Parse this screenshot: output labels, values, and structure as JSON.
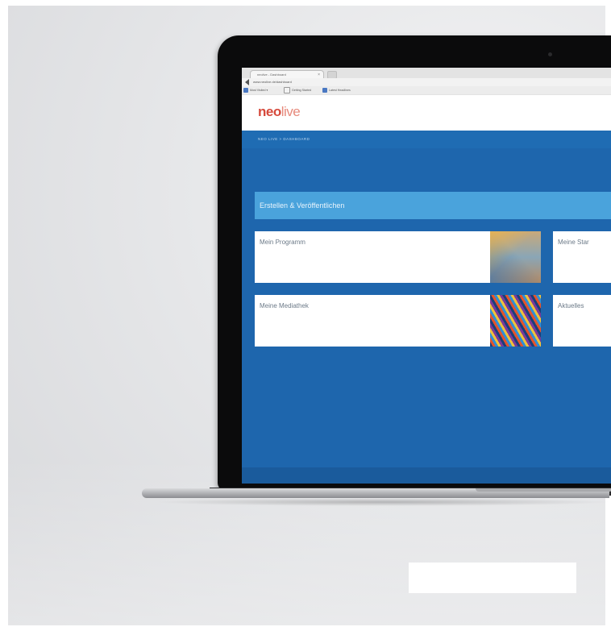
{
  "browser": {
    "tab_title": "neolive - Dashboard",
    "tab_close": "×",
    "address": "www.neolive.de/dashboard",
    "bookmarks": [
      {
        "label": "Most Visited ▾"
      },
      {
        "label": "Getting Started"
      },
      {
        "label": "Latest Headlines"
      }
    ]
  },
  "site": {
    "logo_part1": "neo",
    "logo_part2": "live",
    "breadcrumb": "NEO LIVE  >  DASHBOARD"
  },
  "dashboard": {
    "create_section_label": "Erstellen & Veröffentlichen",
    "cards": [
      {
        "title": "Mein Programm"
      },
      {
        "title": "Meine Star"
      },
      {
        "title": "Meine Mediathek"
      },
      {
        "title": "Aktuelles"
      }
    ]
  },
  "colors": {
    "brand_blue": "#1e66ad",
    "accent_light_blue": "#4aa3dc",
    "logo_red": "#d64a3c"
  }
}
